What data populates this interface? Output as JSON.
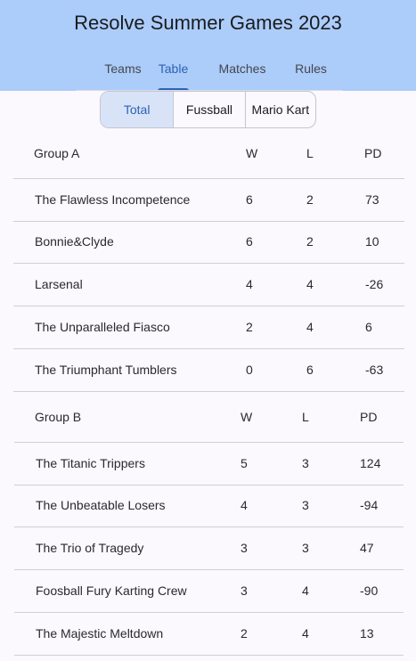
{
  "header": {
    "title": "Resolve Summer Games 2023",
    "tabs": [
      "Teams",
      "Table",
      "Matches",
      "Rules"
    ],
    "active_tab": "Table",
    "accent_color": "#2b63b3",
    "background_color": "#acccfa"
  },
  "segment": {
    "options": [
      "Total",
      "Fussball",
      "Mario Kart"
    ],
    "selected": "Total"
  },
  "groups": [
    {
      "name": "Group A",
      "columns": [
        "W",
        "L",
        "PD"
      ],
      "rows": [
        {
          "team": "The Flawless Incompetence",
          "w": "6",
          "l": "2",
          "pd": "73"
        },
        {
          "team": "Bonnie&Clyde",
          "w": "6",
          "l": "2",
          "pd": "10"
        },
        {
          "team": "Larsenal",
          "w": "4",
          "l": "4",
          "pd": "-26"
        },
        {
          "team": "The Unparalleled Fiasco",
          "w": "2",
          "l": "4",
          "pd": "6"
        },
        {
          "team": "The Triumphant Tumblers",
          "w": "0",
          "l": "6",
          "pd": "-63"
        }
      ]
    },
    {
      "name": "Group B",
      "columns": [
        "W",
        "L",
        "PD"
      ],
      "rows": [
        {
          "team": "The Titanic Trippers",
          "w": "5",
          "l": "3",
          "pd": "124"
        },
        {
          "team": "The Unbeatable Losers",
          "w": "4",
          "l": "3",
          "pd": "-94"
        },
        {
          "team": "The Trio of Tragedy",
          "w": "3",
          "l": "3",
          "pd": "47"
        },
        {
          "team": "Foosball Fury Karting Crew",
          "w": "3",
          "l": "4",
          "pd": "-90"
        },
        {
          "team": "The Majestic Meltdown",
          "w": "2",
          "l": "4",
          "pd": "13"
        }
      ]
    }
  ]
}
